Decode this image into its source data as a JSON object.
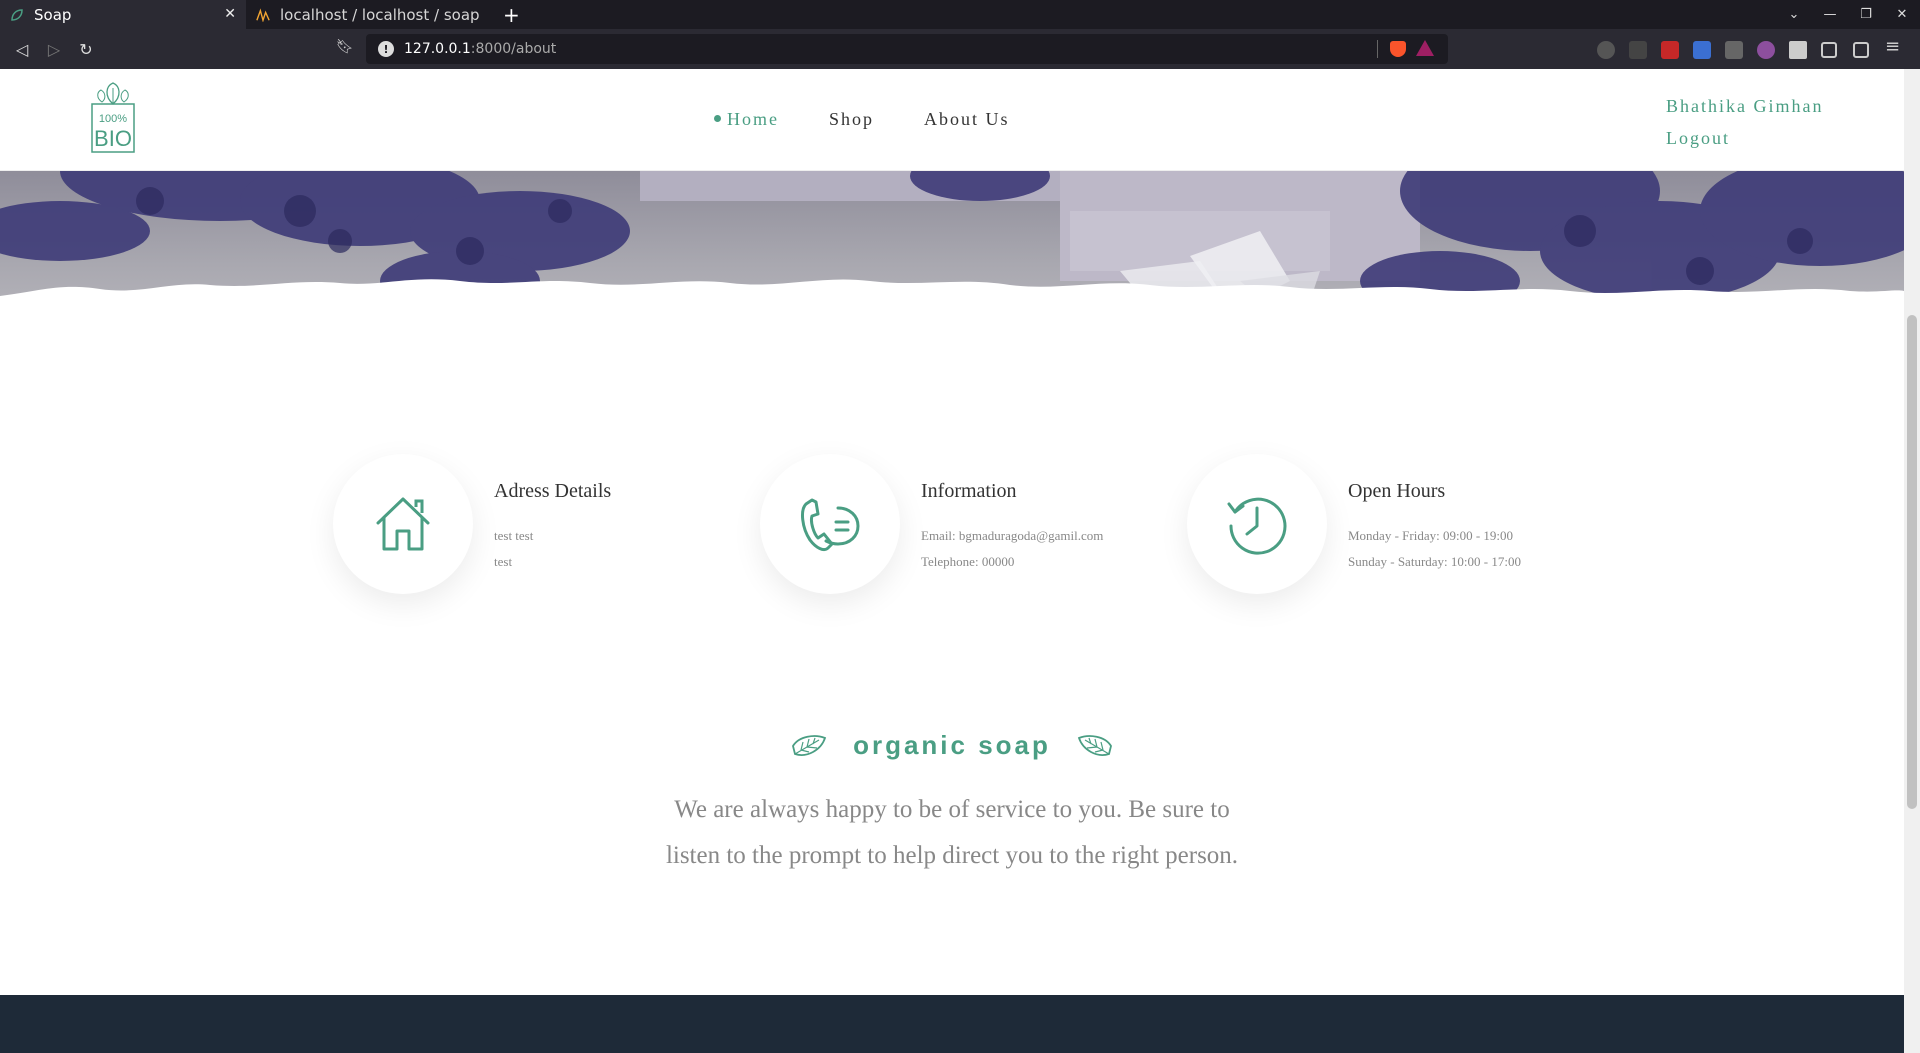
{
  "browser": {
    "tabs": [
      {
        "title": "Soap",
        "active": true
      },
      {
        "title": "localhost / localhost / soap / u",
        "active": false
      }
    ],
    "url": {
      "host": "127.0.0.1",
      "path": ":8000/about"
    },
    "new_tab_label": "+",
    "colors": {
      "chrome": "#2b2a33",
      "tabbar": "#1c1b22"
    }
  },
  "header": {
    "logo_text": "100% BIO",
    "nav": [
      {
        "label": "Home",
        "current": true
      },
      {
        "label": "Shop",
        "current": false
      },
      {
        "label": "About Us",
        "current": false
      }
    ],
    "user": {
      "name": "Bhathika Gimhan",
      "logout": "Logout"
    }
  },
  "contact": [
    {
      "icon": "house-icon",
      "title": "Adress Details",
      "lines": [
        "test test",
        "test"
      ]
    },
    {
      "icon": "phone-chat-icon",
      "title": "Information",
      "lines": [
        "Email: bgmaduragoda@gamil.com",
        "Telephone: 00000"
      ]
    },
    {
      "icon": "clock-history-icon",
      "title": "Open Hours",
      "lines": [
        "Monday - Friday: 09:00 - 19:00",
        "Sunday - Saturday: 10:00 - 17:00"
      ]
    }
  ],
  "organic": {
    "heading": "organic soap",
    "text": "We are always happy to be of service to you. Be sure to listen to the prompt to help direct you to the right person."
  },
  "colors": {
    "accent": "#4a9e83",
    "footer": "#1e2a38",
    "text": "#333333",
    "muted": "#888888"
  }
}
